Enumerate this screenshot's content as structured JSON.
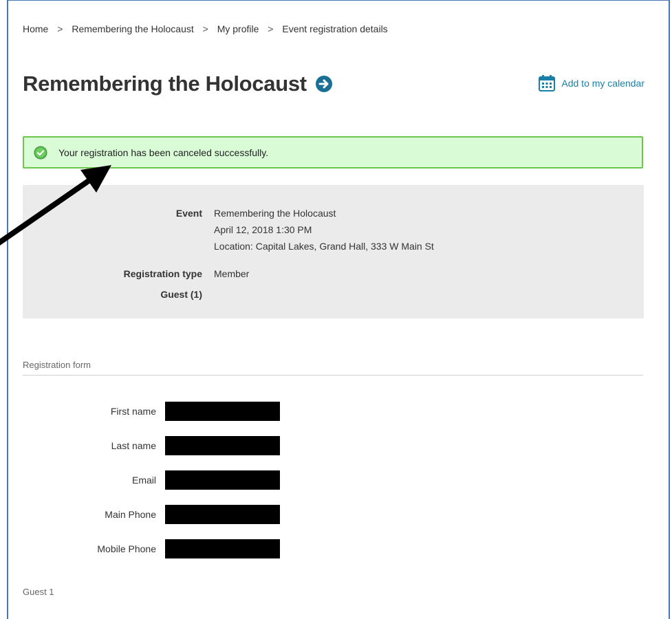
{
  "breadcrumb": {
    "items": [
      "Home",
      "Remembering the Holocaust",
      "My profile",
      "Event registration details"
    ],
    "separator": ">"
  },
  "page": {
    "title": "Remembering the Holocaust",
    "title_icon": "arrow-circle-right-icon",
    "calendar_link": "Add to my calendar",
    "calendar_icon": "calendar-icon"
  },
  "alert": {
    "icon": "check-circle-icon",
    "message": "Your registration has been canceled successfully.",
    "color_bg": "#d9fbd6",
    "color_border": "#6cc64e"
  },
  "details": {
    "event_label": "Event",
    "event_name": "Remembering the Holocaust",
    "event_datetime": "April 12, 2018 1:30 PM",
    "event_location": "Location: Capital Lakes, Grand Hall, 333 W Main St",
    "registration_type_label": "Registration type",
    "registration_type_value": "Member",
    "guest_label": "Guest (1)"
  },
  "form": {
    "section_title": "Registration form",
    "fields": [
      {
        "label": "First name",
        "value": ""
      },
      {
        "label": "Last name",
        "value": ""
      },
      {
        "label": "Email",
        "value": ""
      },
      {
        "label": "Main Phone",
        "value": ""
      },
      {
        "label": "Mobile Phone",
        "value": ""
      }
    ]
  },
  "guest_section": {
    "title": "Guest 1"
  },
  "colors": {
    "accent": "#1a7fa6",
    "frame": "#4a74b8"
  }
}
